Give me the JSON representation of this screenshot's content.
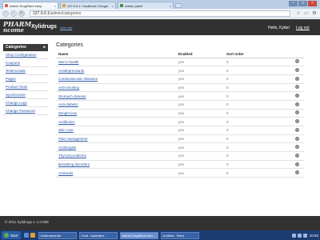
{
  "browser": {
    "tabs": [
      {
        "label": "Admin DrugStore shop",
        "active": true
      },
      {
        "label": "127.0.0.1 / localhost / Drugst",
        "active": false
      },
      {
        "label": "Admin panel",
        "active": false
      }
    ],
    "url": {
      "host": "127.0.0.1",
      "path": "/admin/categories"
    }
  },
  "header": {
    "logo_line1": "PHARM",
    "logo_line2": "ncome",
    "shop_name": "Xylidrugs",
    "view_site": "view site",
    "hello": "Hello, Kyttel",
    "logout": "Log out"
  },
  "sidebar": {
    "title": "Categories",
    "items": [
      {
        "label": "Shop Configuration"
      },
      {
        "label": "Coupons"
      },
      {
        "label": "Testimonials"
      },
      {
        "label": "Pages"
      },
      {
        "label": "Product Tools"
      },
      {
        "label": "Synchronize"
      },
      {
        "label": "Change Logs"
      },
      {
        "label": "Change Password"
      }
    ]
  },
  "main": {
    "title": "Categories",
    "columns": [
      "Name",
      "Enabled",
      "Sort order"
    ],
    "rows": [
      {
        "name": "Men's health",
        "enabled": "yes",
        "sort": "0"
      },
      {
        "name": "Antidepressants",
        "enabled": "yes",
        "sort": "0"
      },
      {
        "name": "Cardiovascular diseases",
        "enabled": "yes",
        "sort": "0"
      },
      {
        "name": "Anti-smoking",
        "enabled": "yes",
        "sort": "0"
      },
      {
        "name": "Stomach disease",
        "enabled": "yes",
        "sort": "0"
      },
      {
        "name": "Anti-diabetic",
        "enabled": "yes",
        "sort": "0"
      },
      {
        "name": "Weight loss",
        "enabled": "yes",
        "sort": "0"
      },
      {
        "name": "Antibiotics",
        "enabled": "yes",
        "sort": "0"
      },
      {
        "name": "Skin care",
        "enabled": "yes",
        "sort": "0"
      },
      {
        "name": "Pain management",
        "enabled": "yes",
        "sort": "0"
      },
      {
        "name": "Antifungals",
        "enabled": "yes",
        "sort": "0"
      },
      {
        "name": "Thyroid problems",
        "enabled": "yes",
        "sort": "0"
      },
      {
        "name": "Breathing disorders",
        "enabled": "yes",
        "sort": "0"
      },
      {
        "name": "Antivirals",
        "enabled": "yes",
        "sort": "0"
      }
    ]
  },
  "footer": {
    "copyright": "© 2011 Xylidrugs v. 1.0.008"
  },
  "taskbar": {
    "start": "Start",
    "tasks": [
      {
        "label": "Ordenamental",
        "active": false
      },
      {
        "label": "Chat - kyttel@m...",
        "active": false
      },
      {
        "label": "Admin DrugStore sho...",
        "active": true
      },
      {
        "label": "Untitled - Paint",
        "active": false
      }
    ],
    "clock": "10:53"
  },
  "colors": {
    "header_bg": "#323232",
    "link": "#2a5aa8",
    "taskbar": "#1d3c72"
  }
}
